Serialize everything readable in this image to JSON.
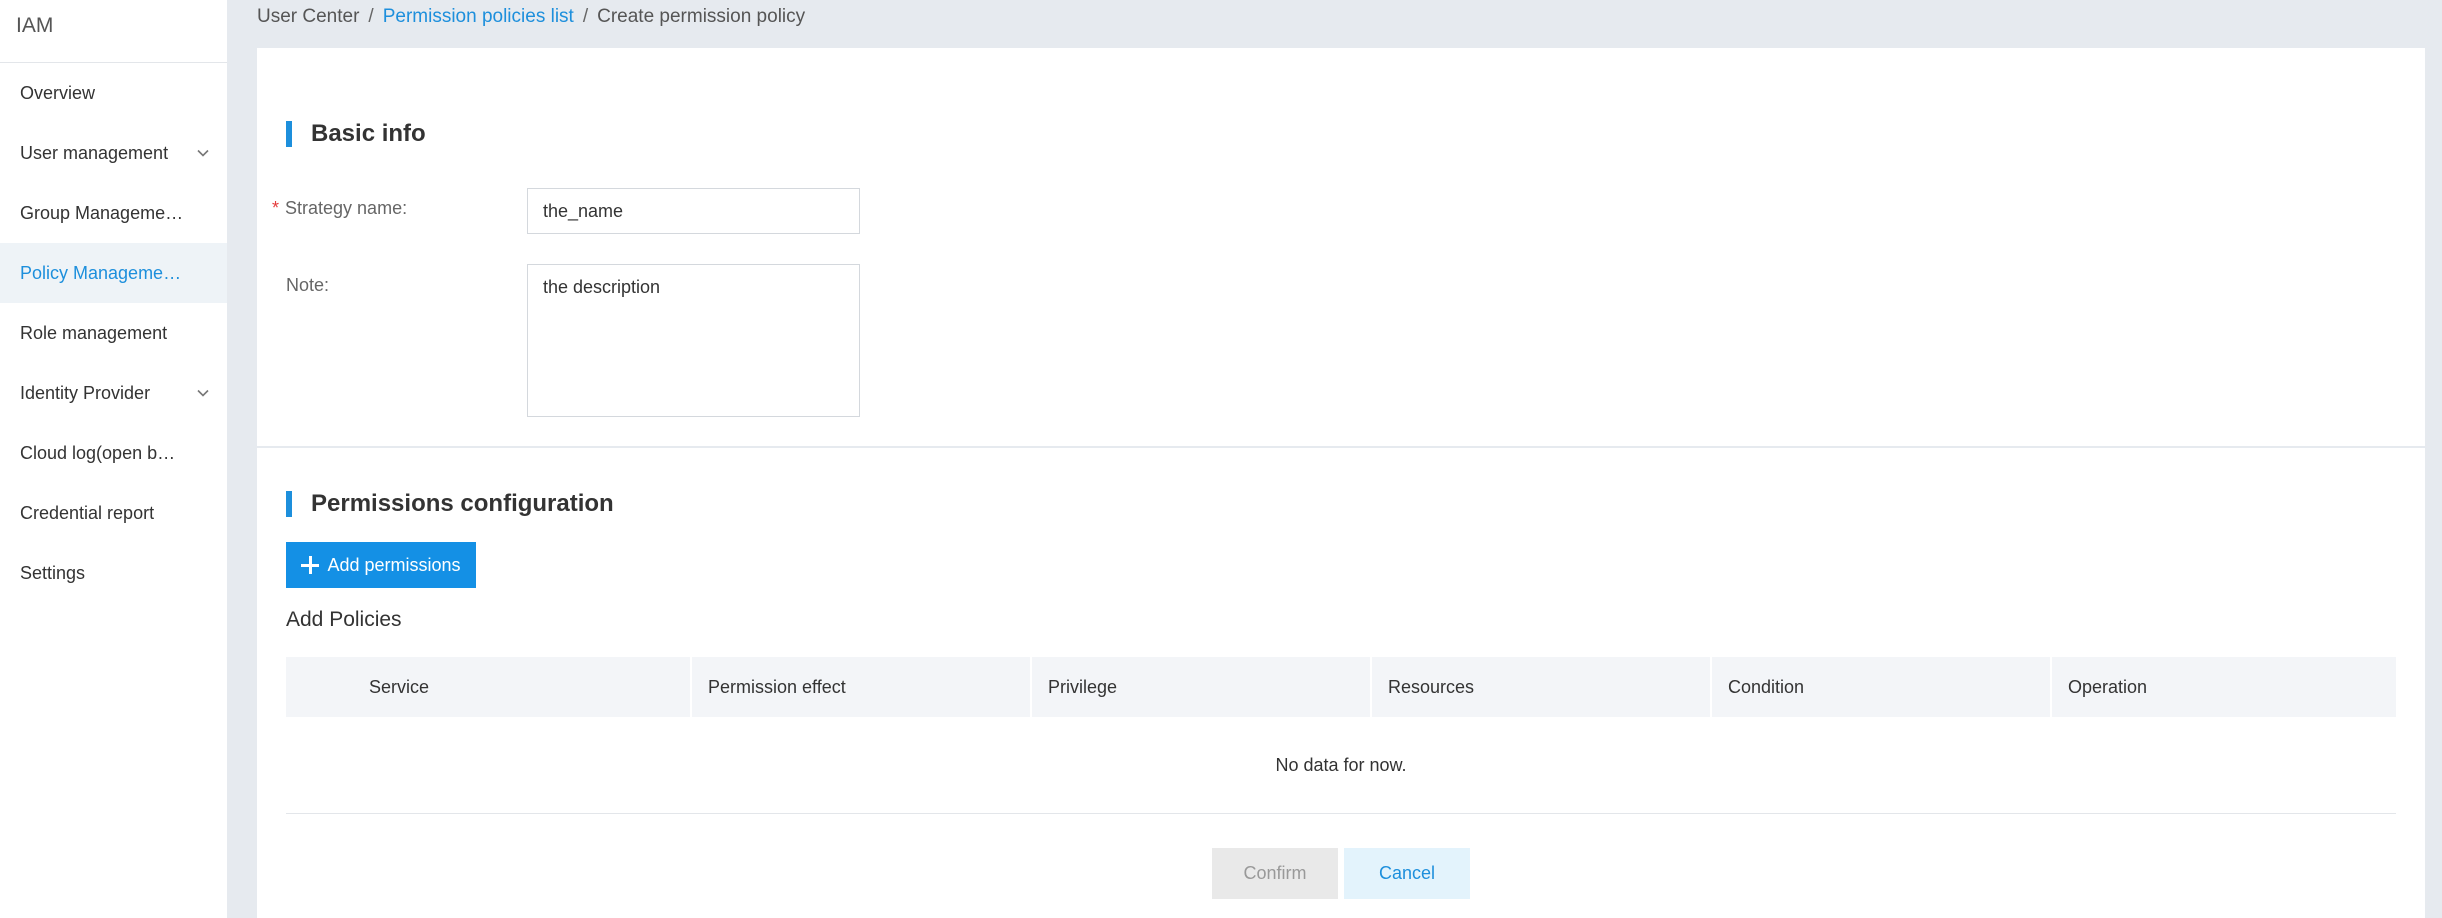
{
  "app": {
    "title": "IAM"
  },
  "sidebar": {
    "items": [
      {
        "label": "Overview",
        "has_submenu": false,
        "active": false
      },
      {
        "label": "User management",
        "has_submenu": true,
        "active": false
      },
      {
        "label": "Group Manageme…",
        "has_submenu": false,
        "active": false
      },
      {
        "label": "Policy Manageme…",
        "has_submenu": false,
        "active": true
      },
      {
        "label": "Role management",
        "has_submenu": false,
        "active": false
      },
      {
        "label": "Identity Provider",
        "has_submenu": true,
        "active": false
      },
      {
        "label": "Cloud log(open b…",
        "has_submenu": false,
        "active": false
      },
      {
        "label": "Credential report",
        "has_submenu": false,
        "active": false
      },
      {
        "label": "Settings",
        "has_submenu": false,
        "active": false
      }
    ]
  },
  "breadcrumb": {
    "root": "User Center",
    "separator": "/",
    "parent": "Permission policies list",
    "current": "Create permission policy"
  },
  "basic_info": {
    "title": "Basic info",
    "required_marker": "*",
    "name_label": "Strategy name:",
    "name_value": "the_name",
    "note_label": "Note:",
    "note_value": "the description"
  },
  "permissions": {
    "title": "Permissions configuration",
    "add_button_label": "Add permissions",
    "subheading": "Add Policies",
    "columns": [
      "Service",
      "Permission effect",
      "Privilege",
      "Resources",
      "Condition",
      "Operation"
    ],
    "empty_text": "No data for now."
  },
  "actions": {
    "confirm_label": "Confirm",
    "cancel_label": "Cancel"
  },
  "colors": {
    "accent": "#1d8fdc",
    "primary_button": "#1490e5",
    "page_background": "#e6eaef",
    "required": "#e43b3b"
  },
  "icons": {
    "chevron": "chevron-down-icon",
    "add": "plus-icon"
  }
}
